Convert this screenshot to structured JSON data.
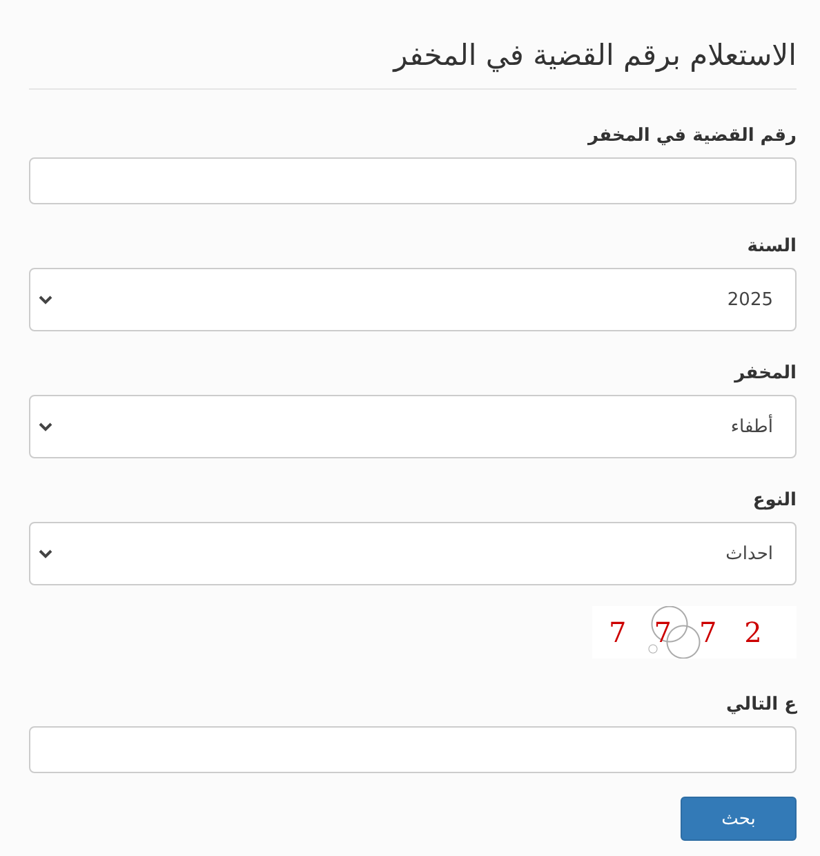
{
  "title": "الاستعلام برقم القضية في المخفر",
  "fields": [
    {
      "kind": "text",
      "label": "رقم القضية في المخفر"
    },
    {
      "kind": "select",
      "label": "السنة",
      "value": "2025"
    },
    {
      "kind": "select",
      "label": "المخفر",
      "value": "أطفاء"
    },
    {
      "kind": "select",
      "label": "النوع",
      "value": "احداث"
    }
  ],
  "captcha": "7772",
  "captcha_field": {
    "label": "ع التالي"
  },
  "submit": "بحث"
}
